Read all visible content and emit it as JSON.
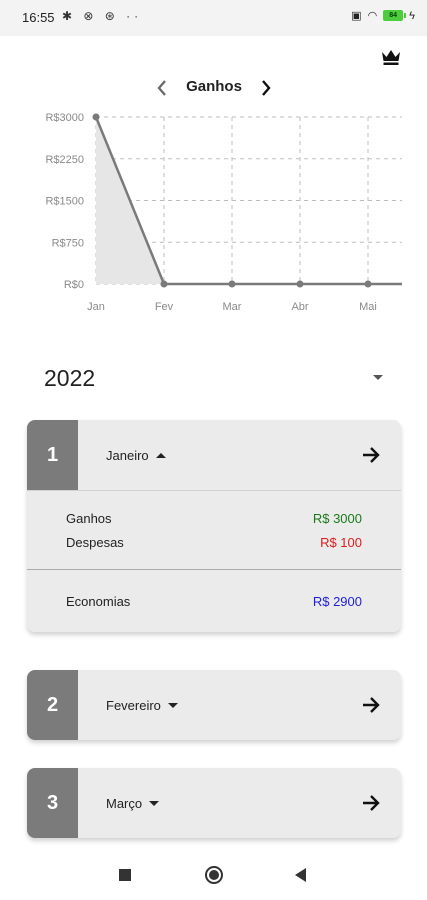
{
  "status_bar": {
    "time": "16:55",
    "left_icons": "✱ ⊗ ⊛ ··",
    "battery": "84"
  },
  "header": {
    "crown_icon": "crown-icon"
  },
  "chart_nav": {
    "title": "Ganhos",
    "prev_icon": "chevron-left-icon",
    "next_icon": "chevron-right-icon"
  },
  "chart_data": {
    "type": "area",
    "categories": [
      "Jan",
      "Fev",
      "Mar",
      "Abr",
      "Mai"
    ],
    "series": [
      {
        "values": [
          3000,
          0,
          0,
          0,
          0
        ]
      }
    ],
    "y_ticks": [
      "R$3000",
      "R$2250",
      "R$1500",
      "R$750",
      "R$0"
    ],
    "ylim": [
      0,
      3000
    ],
    "grid": true,
    "colors": {
      "line": "#7a7a7a",
      "fill": "#e6e6e6",
      "grid": "#bdbdbd"
    }
  },
  "year_selector": {
    "value": "2022"
  },
  "months": [
    {
      "number": "1",
      "name": "Janeiro",
      "expanded": true,
      "rows": [
        {
          "label": "Ganhos",
          "value": "R$ 3000",
          "color": "#1b7a1b"
        },
        {
          "label": "Despesas",
          "value": "R$ 100",
          "color": "#e01b1b"
        }
      ],
      "total": {
        "label": "Economias",
        "value": "R$ 2900",
        "color": "#1f1fd6"
      }
    },
    {
      "number": "2",
      "name": "Fevereiro",
      "expanded": false
    },
    {
      "number": "3",
      "name": "Março",
      "expanded": false
    }
  ]
}
